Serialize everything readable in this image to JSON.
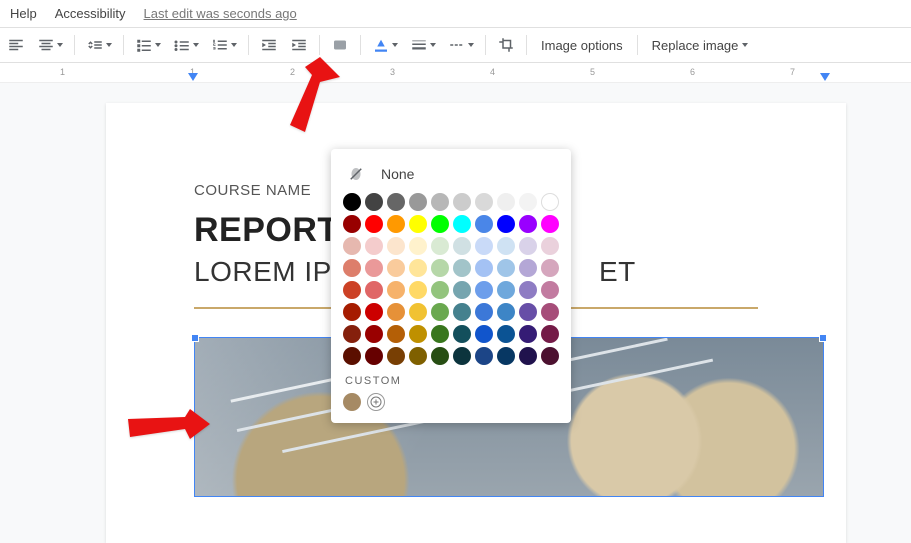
{
  "menu": {
    "help": "Help",
    "accessibility": "Accessibility",
    "edit_status": "Last edit was seconds ago"
  },
  "toolbar": {
    "image_options": "Image options",
    "replace_image": "Replace image"
  },
  "ruler": {
    "numbers": [
      "1",
      "1",
      "2",
      "3",
      "4",
      "5",
      "6",
      "7"
    ]
  },
  "document": {
    "course": "COURSE NAME",
    "title": "REPORT T",
    "subtitle_left": "LOREM IPS",
    "subtitle_right": "ET"
  },
  "color_picker": {
    "none_label": "None",
    "custom_label": "CUSTOM",
    "rows": [
      [
        "#000000",
        "#434343",
        "#666666",
        "#999999",
        "#b7b7b7",
        "#cccccc",
        "#d9d9d9",
        "#efefef",
        "#f3f3f3",
        "#ffffff"
      ],
      [
        "#980000",
        "#ff0000",
        "#ff9900",
        "#ffff00",
        "#00ff00",
        "#00ffff",
        "#4a86e8",
        "#0000ff",
        "#9900ff",
        "#ff00ff"
      ],
      [
        "#e6b8af",
        "#f4cccc",
        "#fce5cd",
        "#fff2cc",
        "#d9ead3",
        "#d0e0e3",
        "#c9daf8",
        "#cfe2f3",
        "#d9d2e9",
        "#ead1dc"
      ],
      [
        "#dd7e6b",
        "#ea9999",
        "#f9cb9c",
        "#ffe599",
        "#b6d7a8",
        "#a2c4c9",
        "#a4c2f4",
        "#9fc5e8",
        "#b4a7d6",
        "#d5a6bd"
      ],
      [
        "#cc4125",
        "#e06666",
        "#f6b26b",
        "#ffd966",
        "#93c47d",
        "#76a5af",
        "#6d9eeb",
        "#6fa8dc",
        "#8e7cc3",
        "#c27ba0"
      ],
      [
        "#a61c00",
        "#cc0000",
        "#e69138",
        "#f1c232",
        "#6aa84f",
        "#45818e",
        "#3c78d8",
        "#3d85c6",
        "#674ea7",
        "#a64d79"
      ],
      [
        "#85200c",
        "#990000",
        "#b45f06",
        "#bf9000",
        "#38761d",
        "#134f5c",
        "#1155cc",
        "#0b5394",
        "#351c75",
        "#741b47"
      ],
      [
        "#5b0f00",
        "#660000",
        "#783f04",
        "#7f6000",
        "#274e13",
        "#0c343d",
        "#1c4587",
        "#073763",
        "#20124d",
        "#4c1130"
      ]
    ],
    "custom_colors": [
      "#a68a64"
    ]
  }
}
